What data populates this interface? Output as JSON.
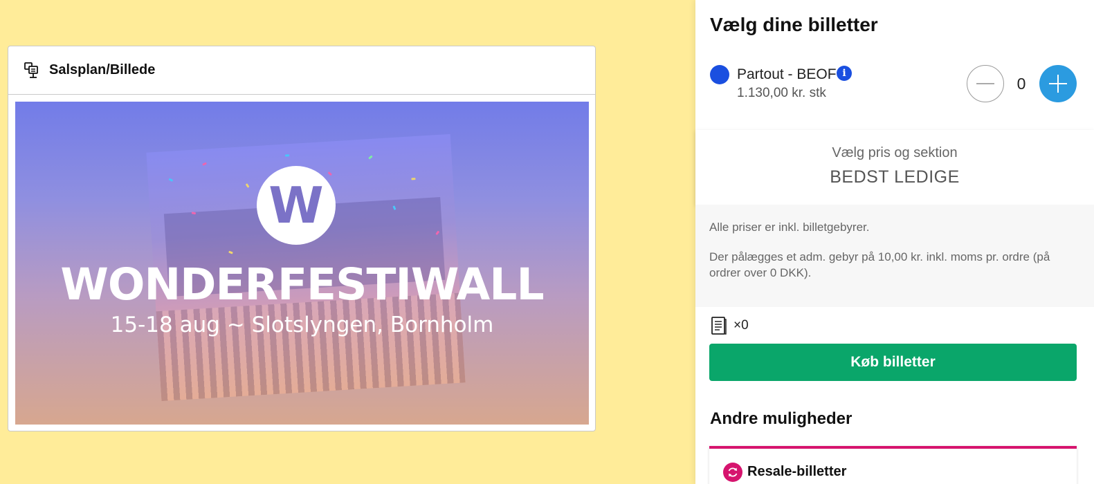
{
  "plan": {
    "header_title": "Salsplan/Billede",
    "banner": {
      "logo_letter": "W",
      "title": "WONDERFESTIWALL",
      "subtitle": "15-18 aug ~ Slotslyngen, Bornholm"
    }
  },
  "panel": {
    "title": "Vælg dine billetter",
    "ticket": {
      "name": "Partout - BEOF",
      "info_icon_label": "i",
      "price": "1.130,00 kr. stk",
      "quantity": "0",
      "dot_color": "#1a4fe0"
    },
    "section": {
      "label": "Vælg pris og sektion",
      "value": "BEDST LEDIGE"
    },
    "notes": [
      "Alle priser er inkl. billetgebyrer.",
      "Der pålægges et adm. gebyr på 10,00 kr. inkl. moms pr. ordre (på ordrer over 0 DKK)."
    ],
    "cart_count": "×0",
    "buy_button": "Køb billetter",
    "other_title": "Andre muligheder",
    "resale_label": "Resale-billetter"
  },
  "colors": {
    "page_background": "#ffec99",
    "buy_button": "#0aa66a",
    "plus_button": "#2b9be0",
    "resale_accent": "#d6146e"
  },
  "icons": {
    "plan": "seating-plan-icon",
    "info": "info-icon",
    "minus": "minus-icon",
    "plus": "plus-icon",
    "cart": "ticket-receipt-icon",
    "resale": "refresh-icon"
  }
}
